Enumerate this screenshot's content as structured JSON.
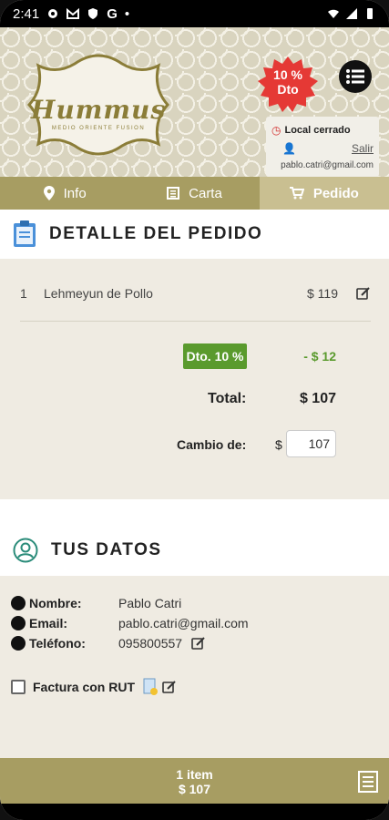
{
  "status_bar": {
    "time": "2:41",
    "letters": "G"
  },
  "header": {
    "logo_text": "Hummus",
    "logo_sub": "MEDIO ORIENTE FUSION",
    "discount_badge": [
      "10 %",
      "Dto"
    ],
    "status": "Local cerrado",
    "logout": "Salir",
    "email": "pablo.catri@gmail.com"
  },
  "tabs": [
    {
      "label": "Info",
      "icon": "pin-icon"
    },
    {
      "label": "Carta",
      "icon": "menu-book-icon"
    },
    {
      "label": "Pedido",
      "icon": "cart-icon",
      "active": true
    }
  ],
  "order": {
    "title": "DETALLE DEL PEDIDO",
    "items": [
      {
        "qty": "1",
        "name": "Lehmeyun de Pollo",
        "price": "$ 119"
      }
    ],
    "discount_label": "Dto. 10 %",
    "discount_value": "- $ 12",
    "total_label": "Total:",
    "total_value": "$ 107",
    "change_label": "Cambio de:",
    "change_currency": "$",
    "change_value": "107"
  },
  "user": {
    "title": "TUS DATOS",
    "name_label": "Nombre:",
    "name": "Pablo Catri",
    "email_label": "Email:",
    "email": "pablo.catri@gmail.com",
    "phone_label": "Teléfono:",
    "phone": "095800557",
    "invoice_label": "Factura con RUT"
  },
  "footer": {
    "items": "1 item",
    "total": "$ 107"
  },
  "colors": {
    "olive": "#a79d62",
    "green": "#5a9a2d",
    "red_badge": "#e53935"
  }
}
